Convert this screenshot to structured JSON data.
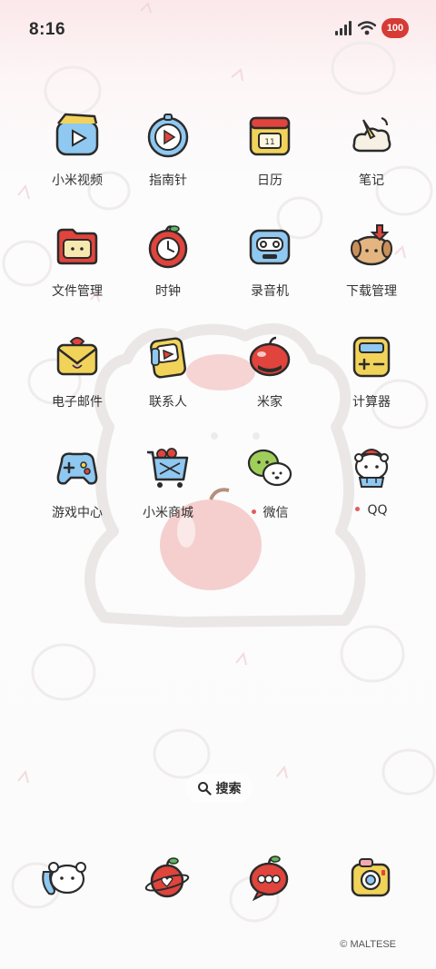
{
  "status_bar": {
    "time": "8:16",
    "battery": "100"
  },
  "apps": [
    {
      "label": "小米视频",
      "icon": "video-icon"
    },
    {
      "label": "指南针",
      "icon": "compass-icon"
    },
    {
      "label": "日历",
      "icon": "calendar-icon"
    },
    {
      "label": "笔记",
      "icon": "notes-icon"
    },
    {
      "label": "文件管理",
      "icon": "folder-icon"
    },
    {
      "label": "时钟",
      "icon": "clock-icon"
    },
    {
      "label": "录音机",
      "icon": "recorder-icon"
    },
    {
      "label": "下载管理",
      "icon": "download-icon"
    },
    {
      "label": "电子邮件",
      "icon": "mail-icon"
    },
    {
      "label": "联系人",
      "icon": "contacts-icon"
    },
    {
      "label": "米家",
      "icon": "mijia-icon"
    },
    {
      "label": "计算器",
      "icon": "calculator-icon"
    },
    {
      "label": "游戏中心",
      "icon": "gamepad-icon"
    },
    {
      "label": "小米商城",
      "icon": "cart-icon"
    },
    {
      "label": "微信",
      "icon": "wechat-icon",
      "new": true
    },
    {
      "label": "QQ",
      "icon": "qq-icon",
      "new": true
    }
  ],
  "search": {
    "label": "搜索",
    "icon": "search-icon"
  },
  "dock": [
    {
      "icon": "phone-icon"
    },
    {
      "icon": "browser-icon"
    },
    {
      "icon": "messages-icon"
    },
    {
      "icon": "camera-icon"
    }
  ],
  "copyright": "© MALTESE",
  "colors": {
    "accent_red": "#d63b35",
    "outline": "#2b2b2b",
    "background": "#fbfbfb"
  }
}
